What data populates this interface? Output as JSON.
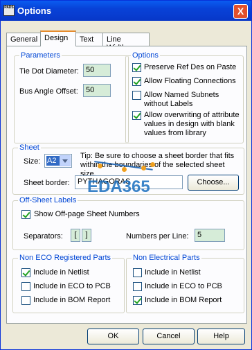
{
  "window": {
    "title": "Options",
    "app_icon": "PADS",
    "close_label": "X"
  },
  "tabs": [
    "General",
    "Design",
    "Text",
    "Line Widths"
  ],
  "parameters": {
    "title": "Parameters",
    "tie_dot_label": "Tie Dot Diameter:",
    "tie_dot_value": "50",
    "bus_angle_label": "Bus Angle Offset:",
    "bus_angle_value": "50"
  },
  "options": {
    "title": "Options",
    "items": [
      {
        "label": "Preserve Ref Des on Paste",
        "checked": true
      },
      {
        "label": "Allow Floating Connections",
        "checked": true
      },
      {
        "label": "Allow Named Subnets without Labels",
        "checked": false
      },
      {
        "label": "Allow overwriting of attribute values in design with blank values from library",
        "checked": true
      }
    ]
  },
  "sheet": {
    "title": "Sheet",
    "size_label": "Size:",
    "size_value": "A2",
    "tip": "Tip: Be sure to choose a sheet border that fits within the boundaries of the selected sheet size.",
    "border_label": "Sheet border:",
    "border_value": "PYTHAGORAS",
    "choose_label": "Choose..."
  },
  "off_sheet": {
    "title": "Off-Sheet Labels",
    "show_label": "Show Off-page Sheet Numbers",
    "show_checked": true,
    "separators_label": "Separators:",
    "sep_left": "[",
    "sep_right": "]",
    "per_line_label": "Numbers per Line:",
    "per_line_value": "5"
  },
  "non_eco": {
    "title": "Non ECO Registered Parts",
    "items": [
      {
        "label": "Include in Netlist",
        "checked": true
      },
      {
        "label": "Include in ECO to PCB",
        "checked": false
      },
      {
        "label": "Include in BOM Report",
        "checked": false
      }
    ]
  },
  "non_electrical": {
    "title": "Non Electrical Parts",
    "items": [
      {
        "label": "Include in Netlist",
        "checked": false
      },
      {
        "label": "Include in ECO to PCB",
        "checked": false
      },
      {
        "label": "Include in BOM Report",
        "checked": true
      }
    ]
  },
  "buttons": {
    "ok": "OK",
    "cancel": "Cancel",
    "help": "Help"
  },
  "watermark": "EDA365"
}
